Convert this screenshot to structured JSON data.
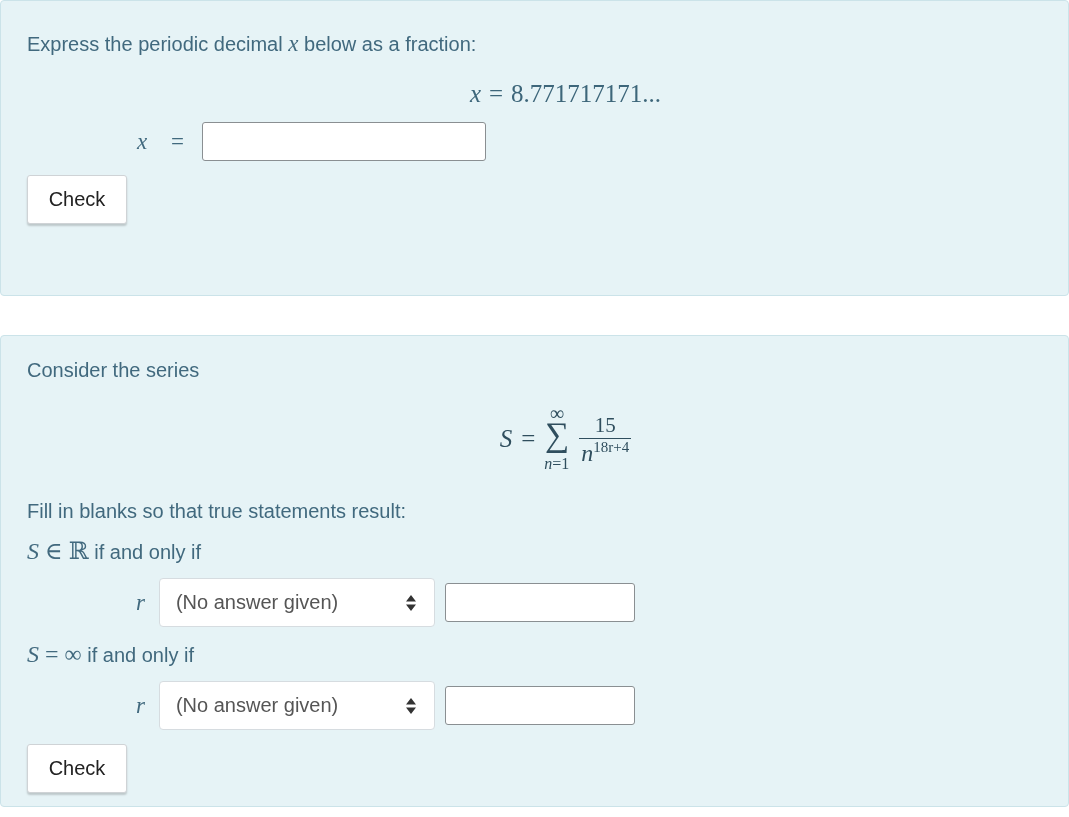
{
  "questions": [
    {
      "prompt": "Express the periodic decimal *x* below as a fraction:",
      "formula": {
        "kind": "equation",
        "lhs": "x",
        "relation": "=",
        "rhs": "8.771717171..."
      },
      "answer": {
        "label": "x",
        "relation": "="
      },
      "button": "Check"
    },
    {
      "prompt": "Consider the series",
      "formula": {
        "kind": "sum",
        "lhs": "S",
        "relation": "=",
        "operator": "∑",
        "upper": "∞",
        "lower": "*n*=1",
        "numerator": "15",
        "base": "n",
        "exponent": "18r+4"
      },
      "instruction": "Fill in blanks so that true statements result:",
      "conditions": [
        {
          "math": "*S* ∈ ℝ",
          "text": "if and only if",
          "variable": "r",
          "choice": "(No answer given)"
        },
        {
          "math": "*S* = ∞",
          "text": "if and only if",
          "variable": "r",
          "choice": "(No answer given)"
        }
      ],
      "button": "Check"
    }
  ]
}
